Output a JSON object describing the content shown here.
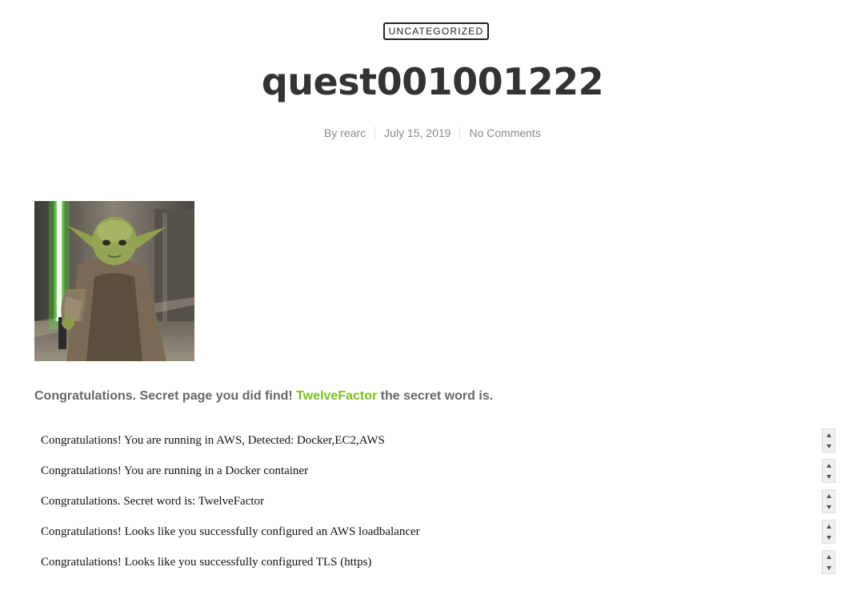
{
  "category": {
    "label": "UNCATEGORIZED"
  },
  "post": {
    "title": "quest001001222",
    "meta": {
      "author": "By rearc",
      "date": "July 15, 2019",
      "comments": "No Comments"
    }
  },
  "image": {
    "icon": "yoda-with-green-lightsaber"
  },
  "secret": {
    "prefix": "Congratulations. Secret page you did find! ",
    "word": "TwelveFactor",
    "suffix": " the secret word is.",
    "accent_color": "#7bc01e"
  },
  "results": [
    {
      "text": "Congratulations! You are running in AWS, Detected: Docker,EC2,AWS"
    },
    {
      "text": "Congratulations! You are running in a Docker container"
    },
    {
      "text": "Congratulations. Secret word is: TwelveFactor"
    },
    {
      "text": "Congratulations! Looks like you successfully configured an AWS loadbalancer"
    },
    {
      "text": "Congratulations! Looks like you successfully configured TLS (https)"
    }
  ]
}
